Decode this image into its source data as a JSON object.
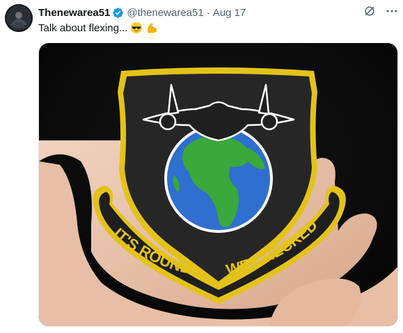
{
  "author": {
    "display_name": "Thenewarea51",
    "handle": "@thenewarea51",
    "separator": "·",
    "date": "Aug 17",
    "verified": true
  },
  "tweet": {
    "text": "Talk about flexing...",
    "emojis": [
      "smiling-face-with-sunglasses",
      "flexed-biceps"
    ]
  },
  "media": {
    "description_icon": "photo",
    "patch_text_left": "IT'S ROUND",
    "patch_text_right": "WE CHECKED"
  },
  "colors": {
    "verified": "#1d9bf0",
    "secondary_text": "#536471",
    "patch_border": "#e3c31a",
    "ocean": "#2f6fcf",
    "land": "#3aa83a"
  },
  "icons": [
    "verified-badge-icon",
    "grok-icon",
    "more-icon"
  ]
}
